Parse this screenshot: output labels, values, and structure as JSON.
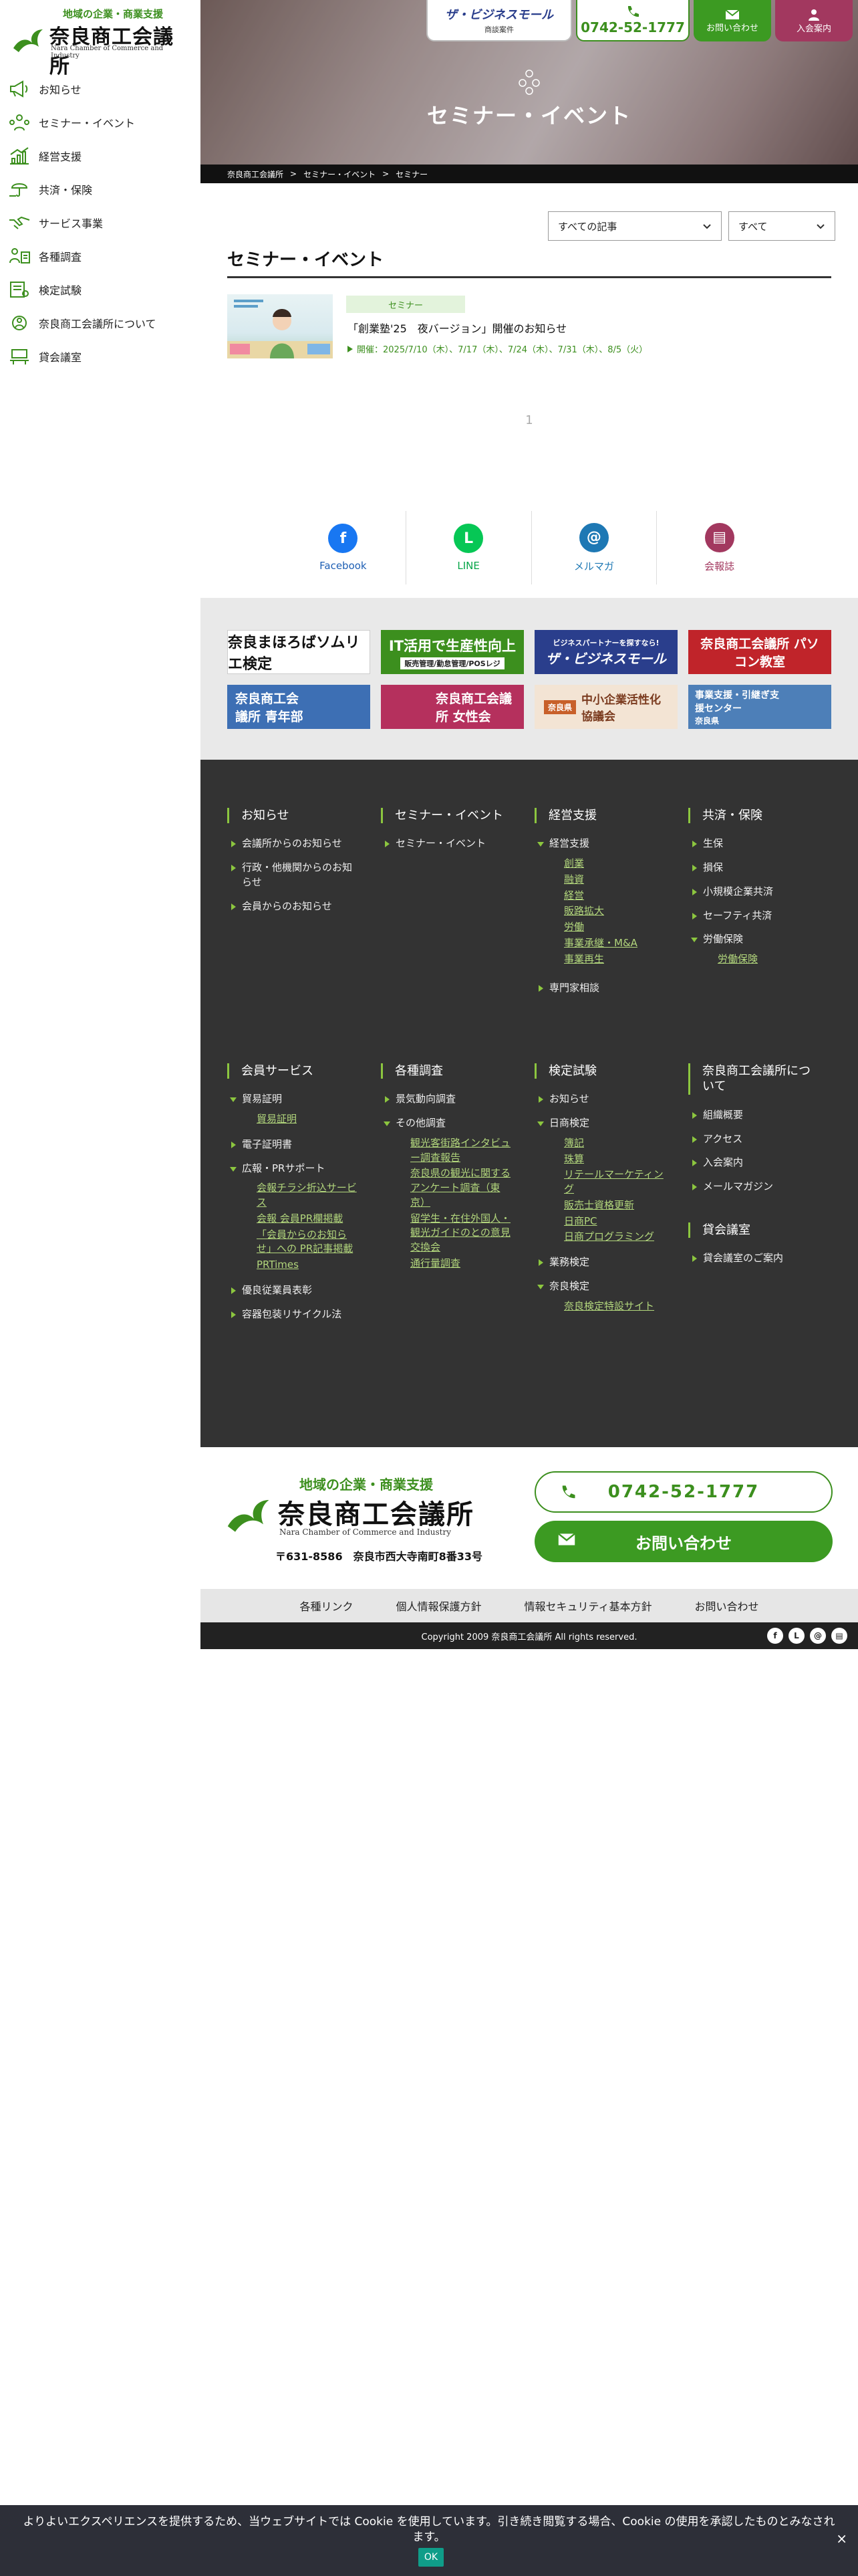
{
  "logo": {
    "tagline": "地域の企業・商業支援",
    "name": "奈良商工会議所",
    "en": "Nara Chamber of Commerce and Industry"
  },
  "sidebar": {
    "items": [
      {
        "label": "お知らせ",
        "icon": "megaphone-icon"
      },
      {
        "label": "セミナー・イベント",
        "icon": "people-icon"
      },
      {
        "label": "経営支援",
        "icon": "growth-chart-icon"
      },
      {
        "label": "共済・保険",
        "icon": "umbrella-hand-icon"
      },
      {
        "label": "サービス事業",
        "icon": "handshake-icon"
      },
      {
        "label": "各種調査",
        "icon": "research-icon"
      },
      {
        "label": "検定試験",
        "icon": "certificate-icon"
      },
      {
        "label": "奈良商工会議所について",
        "icon": "organization-icon"
      },
      {
        "label": "貸会議室",
        "icon": "meeting-room-icon"
      }
    ]
  },
  "header": {
    "bizmall_main": "ザ・ビジネスモール",
    "bizmall_sub": "商談案件",
    "tel": "0742-52-1777",
    "contact": "お問い合わせ",
    "join": "入会案内"
  },
  "hero": {
    "title": "セミナー・イベント"
  },
  "breadcrumb": [
    "奈良商工会議所",
    "セミナー・イベント",
    "セミナー"
  ],
  "breadcrumb_sep": ">",
  "filters": {
    "articles": "すべての記事",
    "all": "すべて"
  },
  "page_title": "セミナー・イベント",
  "post": {
    "category": "セミナー",
    "title": "「創業塾'25　夜バージョン」開催のお知らせ",
    "date": "開催：2025/7/10（木）、7/17（木）、7/24（木）、7/31（木）、8/5（火）"
  },
  "pager": "1",
  "share": [
    {
      "label": "Facebook",
      "color": "#1877f2",
      "glyph": "f"
    },
    {
      "label": "LINE",
      "color": "#06c755",
      "glyph": "L"
    },
    {
      "label": "メルマガ",
      "color": "#1e78b4",
      "glyph": "@"
    },
    {
      "label": "会報誌",
      "color": "#a2385f",
      "glyph": "▤"
    }
  ],
  "banners": [
    {
      "text": "奈良まほろばソムリエ検定",
      "bg": "#ffffff",
      "fg": "#111"
    },
    {
      "text": "IT活用で生産性向上",
      "sub": "販売管理/勤怠管理/POSレジ",
      "bg": "#3c8f1e",
      "fg": "#fff"
    },
    {
      "text": "ザ・ビジネスモール",
      "sub": "ビジネスパートナーを探すなら!",
      "bg": "#2a3e8c",
      "fg": "#fff"
    },
    {
      "text": "奈良商工会議所 パソコン教室",
      "bg": "#c0242a",
      "fg": "#fff"
    },
    {
      "text": "奈良商工会議所 青年部",
      "bg": "#3d6fb4",
      "fg": "#fff"
    },
    {
      "text": "奈良商工会議所 女性会",
      "bg": "#b5305d",
      "fg": "#fff"
    },
    {
      "text": "中小企業活性化協議会",
      "sub": "奈良県",
      "bg": "#f3e4d4",
      "fg": "#7a3a1e"
    },
    {
      "text": "事業支援・引継ぎ支援センター",
      "sub": "奈良県",
      "bg": "#4d7fb8",
      "fg": "#fff"
    }
  ],
  "footer_nav": {
    "oshirase": {
      "head": "お知らせ",
      "links": [
        "会議所からのお知らせ",
        "行政・他機関からのお知らせ",
        "会員からのお知らせ"
      ]
    },
    "seminar": {
      "head": "セミナー・イベント",
      "links": [
        "セミナー・イベント"
      ]
    },
    "keiei": {
      "head": "経営支援",
      "parent": "経営支援",
      "subs": [
        "創業",
        "融資",
        "経営",
        "販路拡大",
        "労働",
        "事業承継・M&A",
        "事業再生"
      ],
      "links": [
        "専門家相談"
      ]
    },
    "kyosai": {
      "head": "共済・保険",
      "links": [
        "生保",
        "損保",
        "小規模企業共済",
        "セーフティ共済"
      ],
      "parent": "労働保険",
      "subs": [
        "労働保険"
      ]
    },
    "kaiin": {
      "head": "会員サービス",
      "p1": "貿易証明",
      "s1": [
        "貿易証明"
      ],
      "l1": "電子証明書",
      "p2": "広報・PRサポート",
      "s2": [
        "会報チラシ折込サービス",
        "会報 会員PR欄掲載",
        "「会員からのお知らせ」への PR記事掲載",
        "PRTimes"
      ],
      "l2": [
        "優良従業員表彰",
        "容器包装リサイクル法"
      ]
    },
    "chosa": {
      "head": "各種調査",
      "l1": "景気動向調査",
      "p1": "その他調査",
      "s1": [
        "観光客街路インタビュー調査報告",
        "奈良県の観光に関するアンケート調査（東京）",
        "留学生・在住外国人・観光ガイドのとの意見交換会",
        "通行量調査"
      ]
    },
    "kentei": {
      "head": "検定試験",
      "l1": "お知らせ",
      "p1": "日商検定",
      "s1": [
        "簿記",
        "珠算",
        "リテールマーケティング",
        "販売士資格更新",
        "日商PC",
        "日商プログラミング"
      ],
      "l2": "業務検定",
      "p2": "奈良検定",
      "s2": [
        "奈良検定特設サイト"
      ]
    },
    "about": {
      "head": "奈良商工会議所について",
      "links": [
        "組織概要",
        "アクセス",
        "入会案内",
        "メールマガジン"
      ]
    },
    "room": {
      "head": "貸会議室",
      "links": [
        "貸会議室のご案内"
      ]
    }
  },
  "footer_info": {
    "tagline": "地域の企業・商業支援",
    "name": "奈良商工会議所",
    "en": "Nara Chamber of Commerce and Industry",
    "address": "〒631-8586　奈良市西大寺南町8番33号",
    "tel": "0742-52-1777",
    "contact": "お問い合わせ"
  },
  "bottom_links": [
    "各種リンク",
    "個人情報保護方針",
    "情報セキュリティ基本方針",
    "お問い合わせ"
  ],
  "copyright": "Copyright 2009 奈良商工会議所 All rights reserved.",
  "cookie": {
    "text": "よりよいエクスペリエンスを提供するため、当ウェブサイトでは Cookie を使用しています。引き続き閲覧する場合、Cookie の使用を承認したものとみなされます。",
    "ok": "OK",
    "close": "×"
  },
  "colors": {
    "brand_green": "#3c8f1e",
    "accent_pink": "#a2385f",
    "dark": "#333333"
  }
}
